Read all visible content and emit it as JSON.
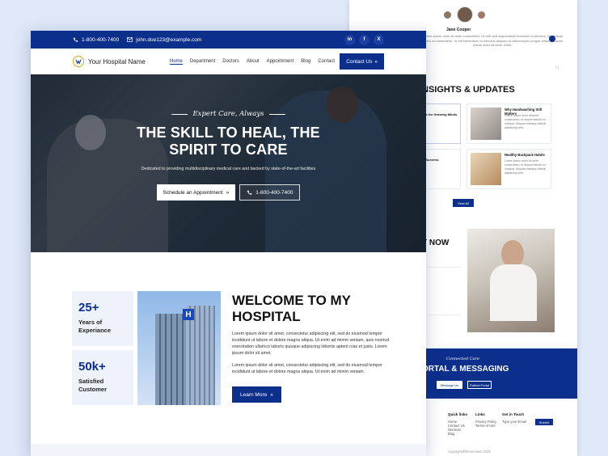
{
  "topbar": {
    "phone": "1-800-400-7400",
    "email": "john.doe123@example.com",
    "social": [
      "in",
      "f",
      "X"
    ]
  },
  "nav": {
    "logo_text": "Your Hospital Name",
    "items": [
      "Home",
      "Department",
      "Doctors",
      "About",
      "Appointment",
      "Blog",
      "Contact"
    ],
    "active": "Home",
    "cta_label": "Contact Us"
  },
  "hero": {
    "tagline": "Expert Care, Always",
    "title_line1": "THE SKILL TO HEAL, THE",
    "title_line2": "SPIRIT TO CARE",
    "subtitle": "Dedicated to providing multidisciplinary medical care and backed by state-of-the-art facilities",
    "primary_button": "Schedule an Appointment",
    "secondary_button": "1-800-400-7400"
  },
  "stats": [
    {
      "number": "25+",
      "label_line1": "Years of",
      "label_line2": "Experiance"
    },
    {
      "number": "50k+",
      "label_line1": "Satisfied",
      "label_line2": "Customer"
    }
  ],
  "welcome": {
    "title_line1": "WELCOME TO MY",
    "title_line2": "HOSPITAL",
    "paragraph1": "Lorem ipsum dolor sit amet, consectetur adipiscing elit, sed do eiusmod tempor incididunt ut labore et dolore magna aliqua. Ut enim ad minim veniam, quis nostrud exercitation ullamco laboris quisque adipiscing lobortis aptent cras et justo. Lorem ipsum dolor sit amet.",
    "paragraph2": "Lorem ipsum dolor sit amet, consectetur adipiscing elit, sed do eiusmod tempor incididunt ut labore et dolore magna aliqua. Ut enim ad minim veniam.",
    "button": "Learn More",
    "building_sign": "H"
  },
  "background_page": {
    "testimonial_name": "Jane Cooper",
    "testimonial_text": "Lorem ipsum dolor sit amet consectetur. Ut velit sed suspendisse tincidunt ut ridiculus. Ut volutpat lectus at consectetur. Ut elit elementum in ridiculus aliquam ut ullamcorper congue tempus. Lorem ipsum dolor sit amet. Amet.",
    "insights_title": "NSIGHTS & UPDATES",
    "cards": [
      {
        "title": "Why Handwashing Still Matters",
        "text": "Lorem ipsum dolor sit amet consectetur. Ut aliquet blandit eu volutpat. Aliquam tristique blandit adipiscing velit."
      },
      {
        "title": "Healthy Backpack Habits",
        "text": "Lorem ipsum dolor sit amet consectetur. Ut aliquet blandit eu volutpat. Aliquam tristique blandit adipiscing velit."
      }
    ],
    "left_card_titles": [
      "ips for Growing Minds",
      "s Success"
    ],
    "view_all": "View All",
    "contact_title": "T NOW",
    "portal_tag": "Connected Care",
    "portal_title": "ORTAL & MESSAGING",
    "message_button": "Message Us",
    "patient_button": "Patient Portal",
    "footer": {
      "quick_links": {
        "title": "Quick links",
        "items": [
          "Home",
          "Contact Us",
          "Services",
          "Blog"
        ]
      },
      "links": {
        "title": "Links",
        "items": [
          "Privacy Policy",
          "Terms of Use"
        ]
      },
      "get_in_touch": {
        "title": "Get in Touch",
        "placeholder": "Type your Email",
        "button": "Submit"
      },
      "copyright": "copyright@lifeunmixes 2026"
    }
  },
  "colors": {
    "primary": "#0d2f8c",
    "page_bg": "#dfe8f8",
    "stat_bg": "#eef3fb"
  }
}
